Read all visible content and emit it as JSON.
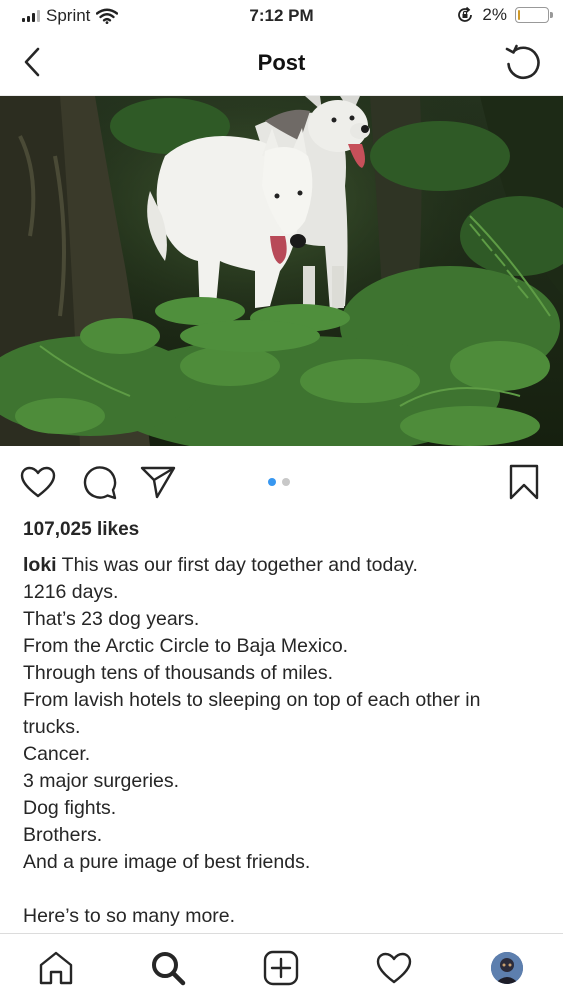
{
  "status_bar": {
    "carrier": "Sprint",
    "time": "7:12 PM",
    "battery": "2%",
    "battery_level": 0.02
  },
  "nav": {
    "title": "Post"
  },
  "post": {
    "likes": "107,025 likes",
    "carousel_index": 1,
    "carousel_count": 2,
    "caption": {
      "username": "loki",
      "first_line": " This was our first day together and today.",
      "lines": [
        "1216 days.",
        "That’s 23 dog years.",
        "From the Arctic Circle to Baja Mexico.",
        "Through tens of thousands of miles.",
        "From lavish hotels to sleeping on top of each other in",
        "trucks.",
        "Cancer.",
        "3 major surgeries.",
        "Dog fights.",
        "Brothers.",
        "And a pure image of best friends.",
        "",
        "Here’s to so many more."
      ]
    }
  },
  "icons": {
    "back": "chevron-left-icon",
    "refresh": "refresh-icon",
    "like": "heart-icon",
    "comment": "comment-icon",
    "share": "send-icon",
    "save": "bookmark-icon",
    "home": "home-icon",
    "search": "search-icon",
    "new_post": "add-post-icon",
    "activity": "heart-icon",
    "profile": "avatar"
  },
  "colors": {
    "active_dot": "#3897f0",
    "inactive_dot": "#c8c8c8",
    "text": "#262626"
  }
}
